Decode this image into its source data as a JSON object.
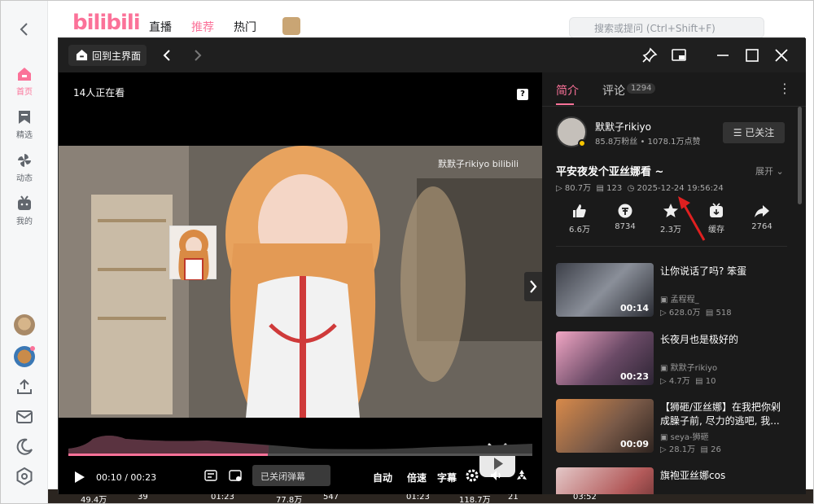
{
  "app": {
    "logo": "bilibili",
    "back_label": "返回"
  },
  "sidebar": {
    "items": [
      {
        "label": "首页"
      },
      {
        "label": "精选"
      },
      {
        "label": "动态"
      },
      {
        "label": "我的"
      }
    ]
  },
  "topbar": {
    "tabs": [
      {
        "label": "直播"
      },
      {
        "label": "推荐"
      },
      {
        "label": "热门"
      }
    ],
    "search_placeholder": "搜索或提问 (Ctrl+Shift+F)"
  },
  "player": {
    "home_label": "回到主界面",
    "viewers": "14人正在看",
    "watermark": "默默子rikiyo bilibili",
    "time_current": "00:10",
    "time_sep": "/",
    "time_total": "00:23",
    "danmaku_placeholder": "已关闭弹幕",
    "quality": "自动",
    "speed": "倍速",
    "subtitle": "字幕",
    "progress": 0.43
  },
  "panel": {
    "tab_intro": "简介",
    "tab_comments": "评论",
    "comment_count": "1294",
    "up_name": "默默子rikiyo",
    "up_stats": "85.8万粉丝 • 1078.1万点赞",
    "follow_label": "☰ 已关注",
    "video_title": "平安夜发个亚丝娜看 ~",
    "expand_label": "展开",
    "views": "80.7万",
    "danmaku_count": "123",
    "publish_time": "2025-12-24 19:56:24",
    "actions": [
      {
        "icon": "like-icon",
        "label": "6.6万"
      },
      {
        "icon": "coin-icon",
        "label": "8734"
      },
      {
        "icon": "star-icon",
        "label": "2.3万"
      },
      {
        "icon": "cache-icon",
        "label": "缓存"
      },
      {
        "icon": "share-icon",
        "label": "2764"
      }
    ],
    "recommendations": [
      {
        "title": "让你说话了吗? 笨蛋",
        "author": "孟程程_",
        "views": "628.0万",
        "danmaku": "518",
        "duration": "00:14"
      },
      {
        "title": "长夜月也是极好的",
        "author": "默默子rikiyo",
        "views": "4.7万",
        "danmaku": "10",
        "duration": "00:23"
      },
      {
        "title": "【狮砸/亚丝娜】在我把你剁成臊子前, 尽力的逃吧, 我...",
        "author": "seya-狮砸",
        "views": "28.1万",
        "danmaku": "26",
        "duration": "00:09"
      },
      {
        "title": "旗袍亚丝娜cos",
        "author": "",
        "views": "",
        "danmaku": "",
        "duration": ""
      }
    ]
  },
  "background_strip": [
    "49.4万",
    "39",
    "01:23",
    "77.8万",
    "547",
    "01:23",
    "118.7万",
    "21",
    "03:52"
  ],
  "colors": {
    "accent": "#fb7299",
    "panel_bg": "#1a1a1a"
  }
}
